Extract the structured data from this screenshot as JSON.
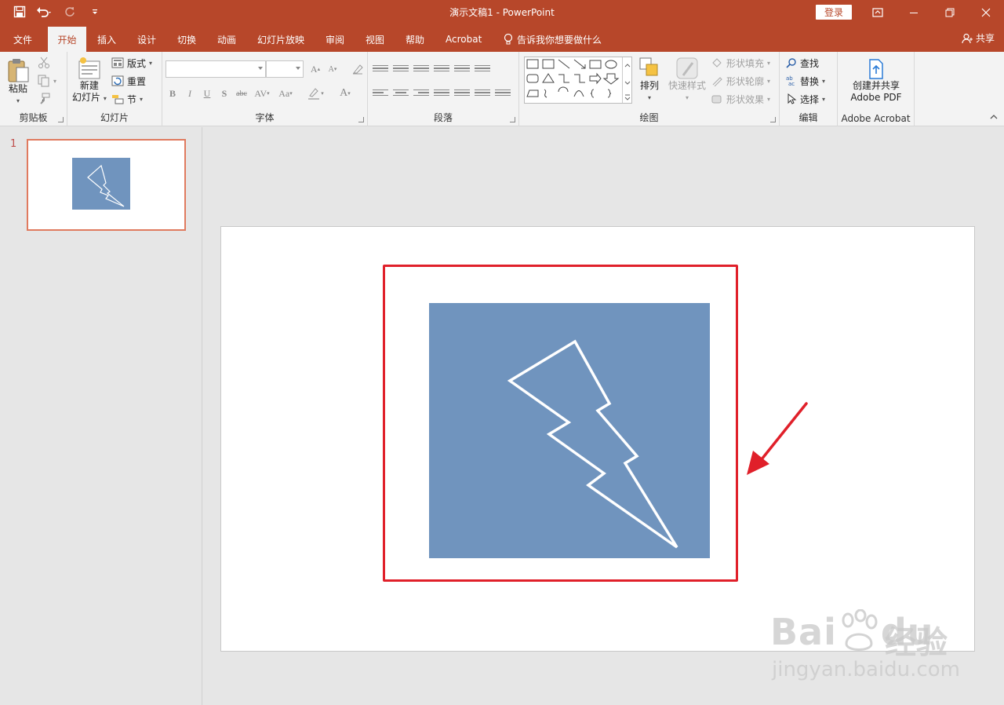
{
  "titlebar": {
    "title": "演示文稿1  -  PowerPoint",
    "login": "登录",
    "bg_color": "#b7472a"
  },
  "tabs": [
    {
      "label": "文件"
    },
    {
      "label": "开始",
      "active": true
    },
    {
      "label": "插入"
    },
    {
      "label": "设计"
    },
    {
      "label": "切换"
    },
    {
      "label": "动画"
    },
    {
      "label": "幻灯片放映"
    },
    {
      "label": "审阅"
    },
    {
      "label": "视图"
    },
    {
      "label": "帮助"
    },
    {
      "label": "Acrobat"
    }
  ],
  "tell_me": "告诉我你想要做什么",
  "share": "共享",
  "ribbon": {
    "clipboard": {
      "paste": "粘贴",
      "label": "剪贴板"
    },
    "slides": {
      "new_slide": "新建",
      "new_slide2": "幻灯片",
      "layout": "版式",
      "reset": "重置",
      "section": "节",
      "label": "幻灯片"
    },
    "font": {
      "label": "字体",
      "font_name": "",
      "font_size": ""
    },
    "paragraph": {
      "label": "段落"
    },
    "drawing": {
      "arrange": "排列",
      "quick_styles": "快速样式",
      "shape_fill": "形状填充",
      "shape_outline": "形状轮廓",
      "shape_effects": "形状效果",
      "label": "绘图"
    },
    "editing": {
      "find": "查找",
      "replace": "替换",
      "select": "选择",
      "label": "编辑"
    },
    "acrobat": {
      "create_share": "创建并共享",
      "adobe_pdf": "Adobe PDF",
      "label": "Adobe Acrobat"
    }
  },
  "thumbnails": [
    {
      "number": "1"
    }
  ],
  "slide": {
    "shape_color": "#7094be",
    "annotation_color": "#e0202a"
  },
  "watermark": {
    "brand": "Bai",
    "brand2": "du",
    "brand_cn": "经验",
    "url": "jingyan.baidu.com"
  }
}
